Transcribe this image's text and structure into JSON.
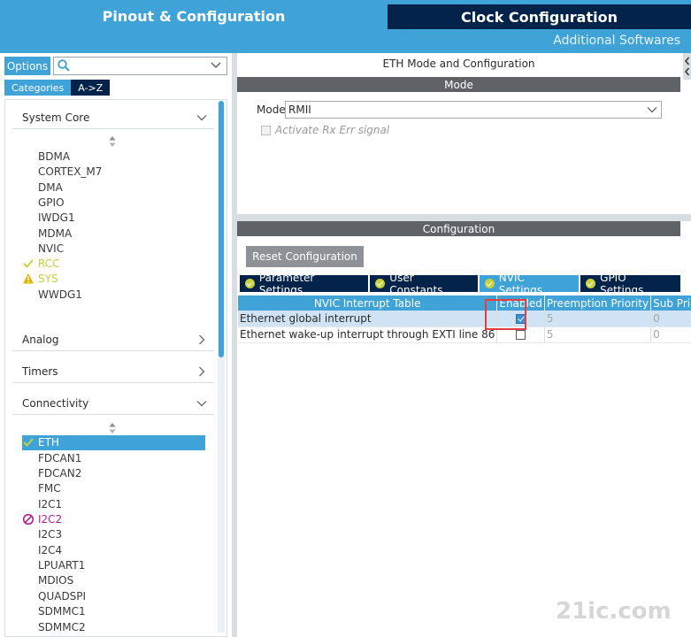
{
  "header": {
    "tab_pinout": "Pinout & Configuration",
    "tab_clock": "Clock Configuration",
    "additional": "Additional Softwares"
  },
  "left": {
    "options_label": "Options",
    "search_value": "",
    "tab_categories": "Categories",
    "tab_az": "A->Z",
    "system_core": {
      "label": "System Core",
      "items": [
        "BDMA",
        "CORTEX_M7",
        "DMA",
        "GPIO",
        "IWDG1",
        "MDMA",
        "NVIC",
        "RCC",
        "SYS",
        "WWDG1"
      ]
    },
    "analog_label": "Analog",
    "timers_label": "Timers",
    "connectivity": {
      "label": "Connectivity",
      "items": [
        "ETH",
        "FDCAN1",
        "FDCAN2",
        "FMC",
        "I2C1",
        "I2C2",
        "I2C3",
        "I2C4",
        "LPUART1",
        "MDIOS",
        "QUADSPI",
        "SDMMC1",
        "SDMMC2"
      ]
    }
  },
  "mode_panel": {
    "title": "ETH Mode and Configuration",
    "section": "Mode",
    "mode_label": "Mode",
    "mode_value": "RMII",
    "rx_err_label": "Activate Rx Err signal"
  },
  "config_panel": {
    "section": "Configuration",
    "reset_label": "Reset Configuration",
    "tabs": [
      "Parameter Settings",
      "User Constants",
      "NVIC Settings",
      "GPIO Settings"
    ],
    "table": {
      "headers": [
        "NVIC Interrupt Table",
        "Enabled",
        "Preemption Priority",
        "Sub Priority"
      ],
      "rows": [
        {
          "name": "Ethernet global interrupt",
          "enabled": true,
          "preemption": "5",
          "sub": "0"
        },
        {
          "name": "Ethernet wake-up interrupt through EXTI line 86",
          "enabled": false,
          "preemption": "5",
          "sub": "0"
        }
      ]
    }
  },
  "colors": {
    "accent": "#40a3d8",
    "dark_navy": "#03234b",
    "ok_green": "#c6d23e",
    "error_magenta": "#b21f8f",
    "highlight_red": "#e53e3e"
  },
  "watermark": "21ic.com"
}
